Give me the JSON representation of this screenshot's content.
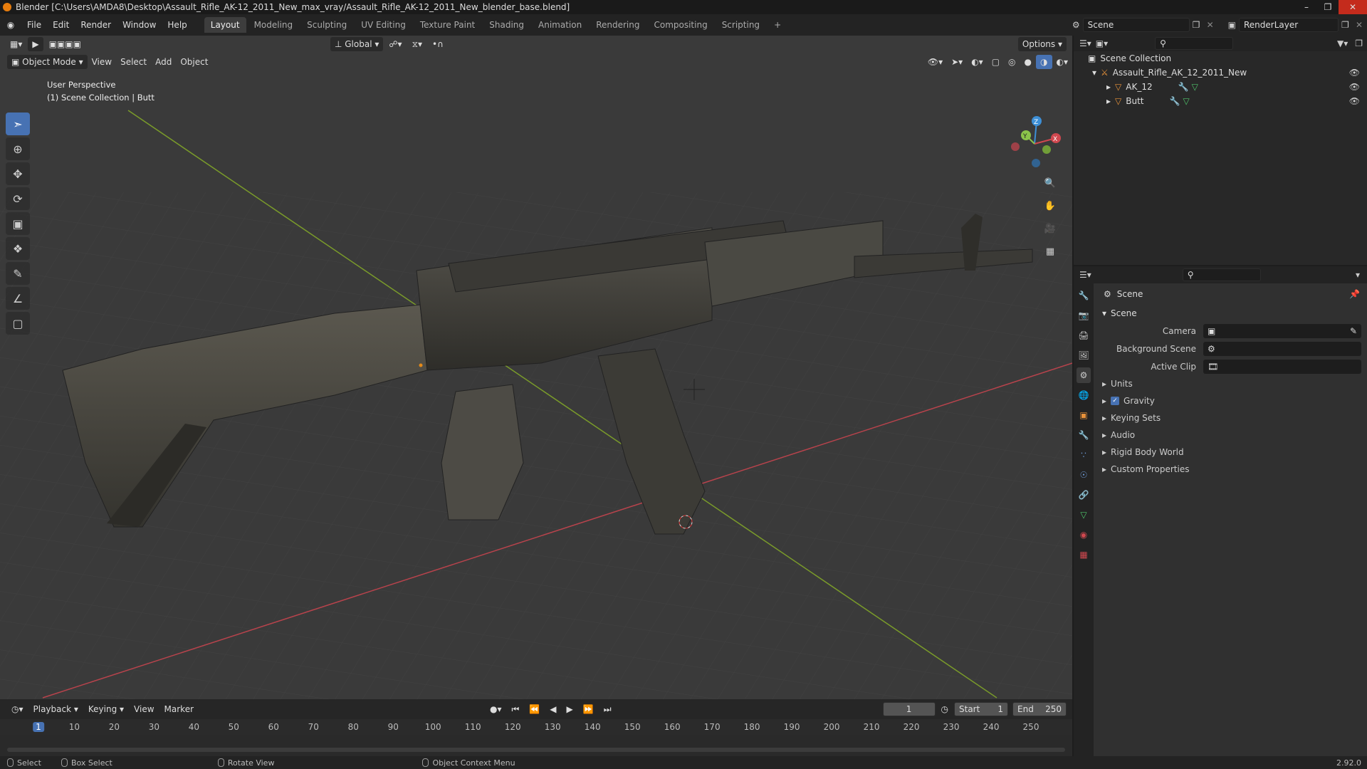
{
  "window": {
    "title": "Blender [C:\\Users\\AMDA8\\Desktop\\Assault_Rifle_AK-12_2011_New_max_vray/Assault_Rifle_AK-12_2011_New_blender_base.blend]"
  },
  "menu": [
    "File",
    "Edit",
    "Render",
    "Window",
    "Help"
  ],
  "workspaces": [
    "Layout",
    "Modeling",
    "Sculpting",
    "UV Editing",
    "Texture Paint",
    "Shading",
    "Animation",
    "Rendering",
    "Compositing",
    "Scripting"
  ],
  "active_workspace": "Layout",
  "scene_field": "Scene",
  "renderlayer_field": "RenderLayer",
  "viewport": {
    "orientation": "Global",
    "options_label": "Options",
    "mode": "Object Mode",
    "menus": [
      "View",
      "Select",
      "Add",
      "Object"
    ],
    "overlay_line1": "User Perspective",
    "overlay_line2": "(1) Scene Collection | Butt",
    "gizmo_axes": {
      "x": "X",
      "y": "Y",
      "z": "Z"
    }
  },
  "timeline": {
    "menus": [
      "Playback",
      "Keying",
      "View",
      "Marker"
    ],
    "current_frame": "1",
    "start_label": "Start",
    "start_value": "1",
    "end_label": "End",
    "end_value": "250",
    "ruler": [
      "1",
      "10",
      "20",
      "30",
      "40",
      "50",
      "60",
      "70",
      "80",
      "90",
      "100",
      "110",
      "120",
      "130",
      "140",
      "150",
      "160",
      "170",
      "180",
      "190",
      "200",
      "210",
      "220",
      "230",
      "240",
      "250"
    ]
  },
  "statusbar": {
    "select": "Select",
    "box_select": "Box Select",
    "rotate": "Rotate View",
    "context": "Object Context Menu",
    "version": "2.92.0"
  },
  "outliner": {
    "root": "Scene Collection",
    "items": [
      {
        "name": "Assault_Rifle_AK_12_2011_New",
        "level": 1
      },
      {
        "name": "AK_12",
        "level": 2
      },
      {
        "name": "Butt",
        "level": 2
      }
    ]
  },
  "properties": {
    "context_title": "Scene",
    "panel": "Scene",
    "rows": [
      {
        "label": "Camera",
        "value": ""
      },
      {
        "label": "Background Scene",
        "value": ""
      },
      {
        "label": "Active Clip",
        "value": ""
      }
    ],
    "subpanels": [
      "Units",
      "Gravity",
      "Keying Sets",
      "Audio",
      "Rigid Body World",
      "Custom Properties"
    ],
    "gravity_checked": true
  },
  "colors": {
    "accent": "#4772b3",
    "x_axis": "#d0484f",
    "y_axis": "#8bc34a",
    "z_axis": "#3d8fd6"
  }
}
